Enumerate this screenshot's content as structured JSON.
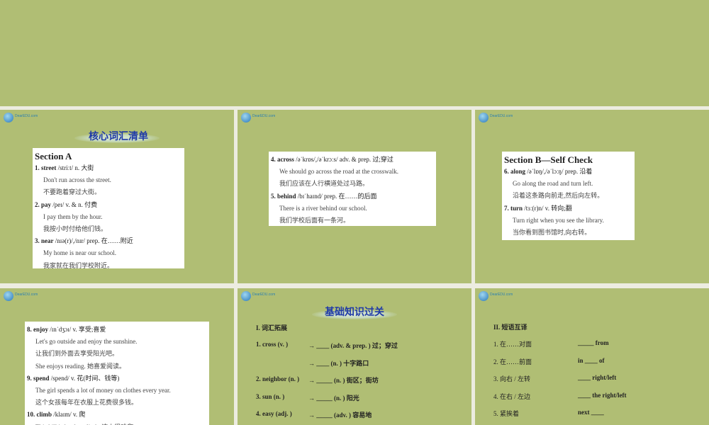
{
  "logo": {
    "text": "DearEDU.com"
  },
  "slide2": {
    "title": "核心词汇清单",
    "section": "Section A",
    "lines": [
      {
        "head": "1. street",
        "rest": " /striːt/   n. 大街"
      },
      {
        "text": "Don't run across the street."
      },
      {
        "text": "不要跑着穿过大街。"
      },
      {
        "head": "2. pay",
        "rest": " /peɪ/   v. & n. 付费"
      },
      {
        "text": "I pay them by the hour."
      },
      {
        "text": "我按小时付给他们钱。"
      },
      {
        "head": "3. near",
        "rest": " /nɪə(r)/,/nɪr/   prep. 在……附近"
      },
      {
        "text": "My home is near our school."
      },
      {
        "text": "我家就在我们学校附近。"
      }
    ]
  },
  "slide3": {
    "lines": [
      {
        "head": "4. across",
        "rest": " /əˈkrɒs/,/əˈkrɔːs/   adv. & prep. 过;穿过"
      },
      {
        "text": "We should go across the road at the crosswalk."
      },
      {
        "text": "我们应该在人行横道处过马路。"
      },
      {
        "head": "5. behind",
        "rest": " /bɪˈhaɪnd/   prep. 在……的后面"
      },
      {
        "text": "There is a river behind our school."
      },
      {
        "text": "我们学校后面有一条河。"
      }
    ]
  },
  "slide4": {
    "section": "Section B—Self Check",
    "lines": [
      {
        "head": "6. along",
        "rest": " /əˈlɒŋ/,/əˈlɔːŋ/   prep. 沿着"
      },
      {
        "text": "Go along the road and turn left."
      },
      {
        "text": "沿着这条路向前走,然后向左转。"
      },
      {
        "head": "7. turn",
        "rest": " /tɜː(r)n/   v. 转向;翻"
      },
      {
        "text": "Turn right when you see the library."
      },
      {
        "text": "当你看到图书馆时,向右转。"
      }
    ]
  },
  "slide5": {
    "lines": [
      {
        "head": "8. enjoy",
        "rest": " /ɪnˈdʒɔɪ/   v. 享受;喜爱"
      },
      {
        "text": "Let's go outside and enjoy the sunshine."
      },
      {
        "text": "让我们到外面去享受阳光吧。"
      },
      {
        "text": "She enjoys reading. 她喜爱阅读。"
      },
      {
        "head": "9. spend",
        "rest": " /spend/   v. 花(时间、钱等)"
      },
      {
        "text": "The girl spends a lot of money on clothes every year."
      },
      {
        "text": "这个女孩每年在衣服上花费很多钱。"
      },
      {
        "head": "10. climb",
        "rest": " /klaɪm/   v. 爬"
      },
      {
        "text": "This hill is hard to climb. 这山很难爬。"
      }
    ]
  },
  "slide6": {
    "title": "基础知识过关",
    "heading": "I. 词汇拓展",
    "rows": [
      {
        "left": "1. cross (v. )",
        "right": "→ ____ (adv. & prep. ) 过；穿过"
      },
      {
        "left": "",
        "right": "→ ____ (n. ) 十字路口"
      },
      {
        "left": "2. neighbor (n. )",
        "right": "→ _____ (n. ) 街区；街坊"
      },
      {
        "left": "3. sun (n. )",
        "right": "→ _____ (n. )  阳光"
      },
      {
        "left": "4. easy (adj. )",
        "right": "→ _____ (adv. ) 容易地"
      }
    ]
  },
  "slide7": {
    "heading": "II. 短语互译",
    "rows": [
      {
        "left": "1.  在……对面",
        "right": "_____ from"
      },
      {
        "left": "2.  在……前面",
        "right": "in ____ of"
      },
      {
        "left": "3.  向右 / 左转",
        "right": "____ right/left"
      },
      {
        "left": "4.  在右 / 左边",
        "right": "____ the right/left"
      },
      {
        "left": "5.  紧挨着",
        "right": "next ____"
      }
    ]
  }
}
